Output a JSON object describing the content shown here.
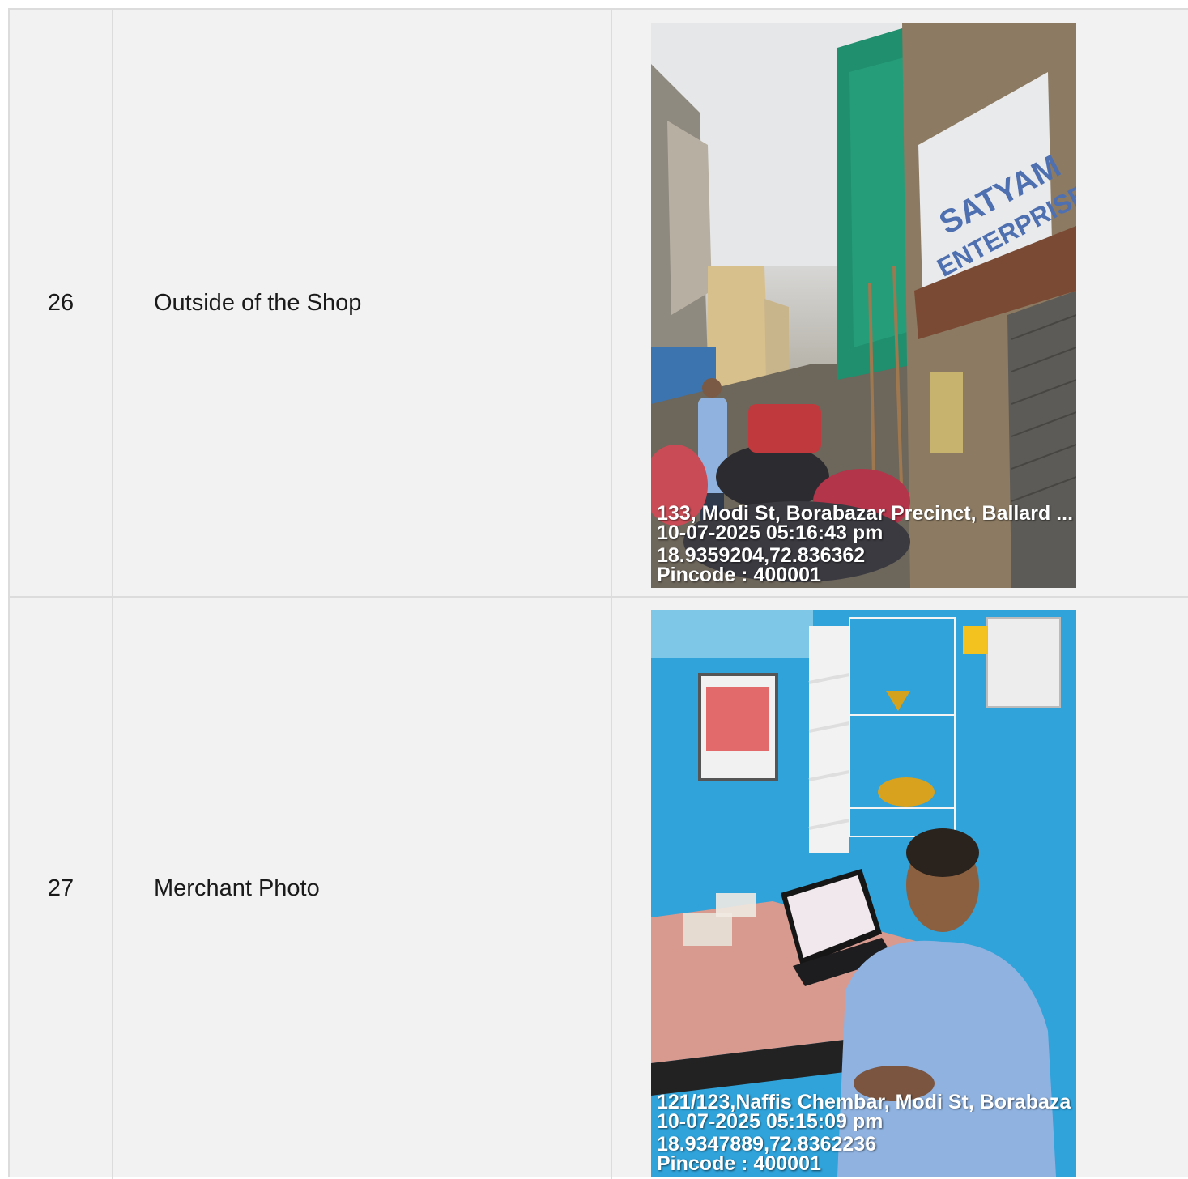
{
  "rows": [
    {
      "number": "26",
      "description": "Outside of the Shop",
      "photo": {
        "sign_line1": "SATYAM",
        "sign_line2": "ENTERPRISES",
        "overlay": {
          "address": "133, Modi St, Borabazar Precinct, Ballard ...",
          "datetime": "10-07-2025 05:16:43 pm",
          "coords": "18.9359204,72.836362",
          "pincode": "Pincode : 400001"
        }
      }
    },
    {
      "number": "27",
      "description": "Merchant Photo",
      "photo": {
        "overlay": {
          "address": "121/123,Naffis Chembar, Modi St, Borabaza",
          "datetime": "10-07-2025 05:15:09 pm",
          "coords": "18.9347889,72.8362236",
          "pincode": "Pincode : 400001"
        }
      }
    }
  ]
}
